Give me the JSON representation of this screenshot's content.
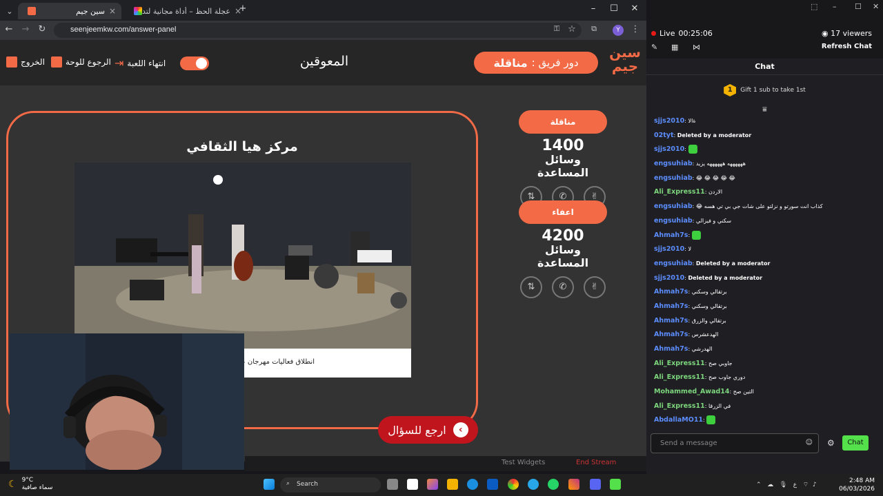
{
  "browser": {
    "tabs": [
      {
        "label": "سين جيم",
        "active": true
      },
      {
        "label": "عجلة الحظ – أداة مجانية لتدوير ال",
        "active": false
      }
    ],
    "url": "seenjeemkw.com/answer-panel",
    "profile_initial": "Y"
  },
  "app": {
    "logo_text": "سين جيم",
    "turn_label": "دور فريق :",
    "turn_team": "مناقلة",
    "topic": "المعوقين",
    "end_game": "انتهاء اللعبة",
    "back_to_board": "الرجوع للوحة",
    "exit": "الخروج",
    "question_title": "مركز هيا الثقافي",
    "caption": "انطلاق فعاليات مهرجان عم",
    "back_to_question": "ارجع للسؤال",
    "teams": [
      {
        "name": "مناقلة",
        "score": "1400",
        "aids_label": "وسائل المساعدة"
      },
      {
        "name": "اعفاء",
        "score": "4200",
        "aids_label": "وسائل المساعدة"
      }
    ],
    "accent": "#f26a46"
  },
  "stream": {
    "live_label": "Live",
    "timer": "00:25:06",
    "viewers": "17 viewers",
    "refresh": "Refresh Chat",
    "chat_title": "Chat",
    "gift_text": "Gift 1 sub to take 1st",
    "gift_rank": "1",
    "messages": [
      {
        "user": "sjjs2010",
        "color": "#5c8dff",
        "text": "ةالا"
      },
      {
        "user": "02tyt",
        "color": "#5c8dff",
        "text": "Deleted by a moderator",
        "deleted": true
      },
      {
        "user": "sjjs2010",
        "color": "#5c8dff",
        "text": "",
        "emote": true
      },
      {
        "user": "engsuhiab",
        "color": "#5c8dff",
        "text": "ههههههه ههههههه يزيد"
      },
      {
        "user": "engsuhiab",
        "color": "#5c8dff",
        "text": "😂 😂 😂 😂 😂"
      },
      {
        "user": "Ali_Express11",
        "color": "#7dd67d",
        "text": "الاردن"
      },
      {
        "user": "engsuhiab",
        "color": "#5c8dff",
        "text": "😂 كذاب انت سورتو و نزلتو على شات جي بي تي هسه"
      },
      {
        "user": "engsuhiab",
        "color": "#5c8dff",
        "text": "سكني و فيزالي"
      },
      {
        "user": "Ahmah7s",
        "color": "#5c8dff",
        "text": "",
        "emote": true
      },
      {
        "user": "sjjs2010",
        "color": "#5c8dff",
        "text": "لا"
      },
      {
        "user": "engsuhiab",
        "color": "#5c8dff",
        "text": "Deleted by a moderator",
        "deleted": true
      },
      {
        "user": "sjjs2010",
        "color": "#5c8dff",
        "text": "Deleted by a moderator",
        "deleted": true
      },
      {
        "user": "Ahmah7s",
        "color": "#5c8dff",
        "text": "برتقالي وسكني"
      },
      {
        "user": "Ahmah7s",
        "color": "#5c8dff",
        "text": "برتقالي وسكني"
      },
      {
        "user": "Ahmah7s",
        "color": "#5c8dff",
        "text": "برتقالي والزرق"
      },
      {
        "user": "Ahmah7s",
        "color": "#5c8dff",
        "text": "الهدعشرس"
      },
      {
        "user": "Ahmah7s",
        "color": "#5c8dff",
        "text": "الهدرشي"
      },
      {
        "user": "Ali_Express11",
        "color": "#7dd67d",
        "text": "جاوبي صح"
      },
      {
        "user": "Ali_Express11",
        "color": "#7dd67d",
        "text": "دوري جاوب صح"
      },
      {
        "user": "Mohammed_Awad14",
        "color": "#7dd67d",
        "text": "التين صح"
      },
      {
        "user": "Ali_Express11",
        "color": "#7dd67d",
        "text": "في الزرقا"
      },
      {
        "user": "AbdallaMO11",
        "color": "#5c8dff",
        "text": "",
        "emote": true
      }
    ],
    "input_placeholder": "Send a message",
    "send_label": "Chat"
  },
  "behind": {
    "test_widgets": "Test Widgets",
    "end_stream": "End Stream"
  },
  "taskbar": {
    "temp": "9°C",
    "weather": "سماء صافية",
    "search": "Search",
    "lang": "ع",
    "time": "2:48 AM",
    "date": "06/03/2026"
  }
}
